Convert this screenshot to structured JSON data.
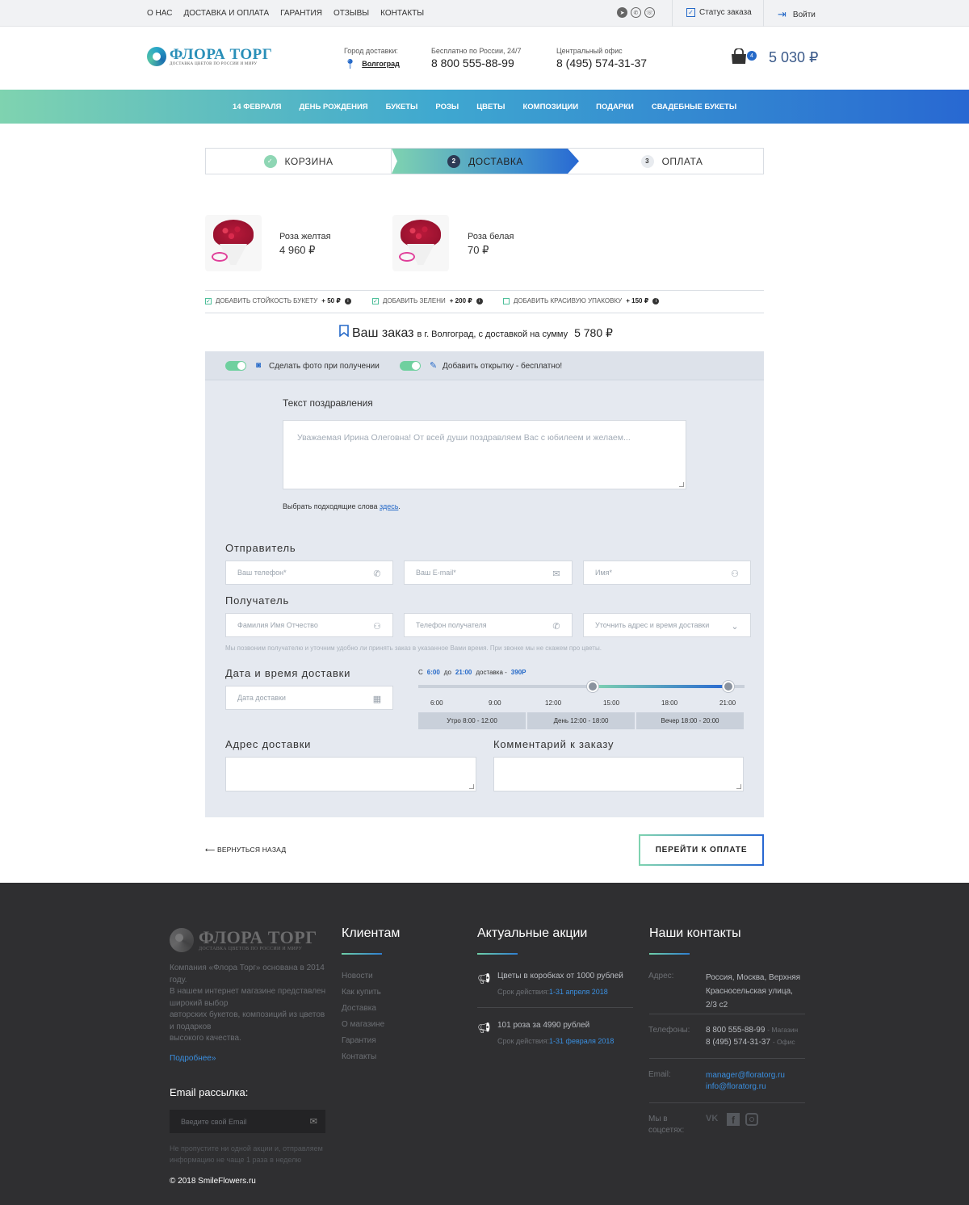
{
  "topbar": {
    "nav": [
      "О НАС",
      "ДОСТАВКА И ОПЛАТА",
      "ГАРАНТИЯ",
      "ОТЗЫВЫ",
      "КОНТАКТЫ"
    ],
    "order_status": "Статус заказа",
    "login": "Войти"
  },
  "header": {
    "logo_title": "ФЛОРА ТОРГ",
    "logo_sub": "ДОСТАВКА ЦВЕТОВ ПО РОССИИ И МИРУ",
    "city_label": "Город доставки:",
    "city_value": "Волгоград",
    "phone1_label": "Бесплатно по России, 24/7",
    "phone1": "8 800 555-88-99",
    "phone2_label": "Центральный офис",
    "phone2": "8 (495) 574-31-37",
    "cart_count": "4",
    "cart_total": "5 030 ₽"
  },
  "mainnav": [
    "14 ФЕВРАЛЯ",
    "ДЕНЬ РОЖДЕНИЯ",
    "БУКЕТЫ",
    "РОЗЫ",
    "ЦВЕТЫ",
    "КОМПОЗИЦИИ",
    "ПОДАРКИ",
    "СВАДЕБНЫЕ БУКЕТЫ"
  ],
  "steps": [
    {
      "num": "✓",
      "label": "КОРЗИНА"
    },
    {
      "num": "2",
      "label": "ДОСТАВКА"
    },
    {
      "num": "3",
      "label": "ОПЛАТА"
    }
  ],
  "products": [
    {
      "name": "Роза желтая",
      "price": "4 960 ₽"
    },
    {
      "name": "Роза белая",
      "price": "70 ₽"
    }
  ],
  "options": [
    {
      "label": "ДОБАВИТЬ СТОЙКОСТЬ БУКЕТУ",
      "price": "+ 50 ₽"
    },
    {
      "label": "ДОБАВИТЬ ЗЕЛЕНИ",
      "price": "+ 200 ₽"
    },
    {
      "label": "ДОБАВИТЬ КРАСИВУЮ УПАКОВКУ",
      "price": "+ 150 ₽"
    }
  ],
  "order": {
    "title": "Ваш заказ",
    "desc": "в г. Волгоград, с доставкой на сумму",
    "sum": "5 780 ₽"
  },
  "form": {
    "photo_toggle": "Сделать фото при получении",
    "card_toggle": "Добавить открытку - бесплатно!",
    "greeting_title": "Текст поздравления",
    "greeting_placeholder": "Уважаемая Ирина Олеговна! От всей души поздравляем Вас с юбилеем и желаем...",
    "pick_words": "Выбрать подходящие слова",
    "pick_link": "здесь",
    "sender_title": "Отправитель",
    "sender_phone": "Ваш телефон*",
    "sender_email": "Ваш E-mail*",
    "sender_name": "Имя*",
    "recipient_title": "Получатель",
    "recipient_name": "Фамилия Имя Отчество",
    "recipient_phone": "Телефон получателя",
    "recipient_address_select": "Уточнить адрес и время доставки",
    "recipient_note": "Мы позвоним получателю и уточним удобно ли принять заказ в указанное Вами время. При звонке мы не скажем про цветы.",
    "date_title": "Дата и время доставки",
    "date_placeholder": "Дата доставки",
    "range_from_label": "С",
    "range_from": "6:00",
    "range_to_label": "до",
    "range_to": "21:00",
    "range_price_label": "доставка -",
    "range_price": "390Р",
    "ticks": [
      "6:00",
      "9:00",
      "12:00",
      "15:00",
      "18:00",
      "21:00"
    ],
    "periods": [
      "Утро 8:00 - 12:00",
      "День 12:00 - 18:00",
      "Вечер 18:00 - 20:00"
    ],
    "address_title": "Адрес доставки",
    "comment_title": "Комментарий к заказу"
  },
  "actions": {
    "back": "⟵ ВЕРНУТЬСЯ НАЗАД",
    "pay": "ПЕРЕЙТИ К ОПЛАТЕ"
  },
  "footer": {
    "logo_title": "ФЛОРА ТОРГ",
    "logo_sub": "ДОСТАВКА ЦВЕТОВ ПО РОССИИ И МИРУ",
    "about": [
      "Компания «Флора Торг» основана в 2014 году.",
      "В нашем интернет магазине представлен широкий выбор",
      "авторских букетов, композиций из цветов и подарков",
      "высокого качества."
    ],
    "more": "Подробнее»",
    "newsletter_title": "Email рассылка:",
    "newsletter_placeholder": "Введите свой Email",
    "newsletter_note": "Не пропустите ни одной акции и, отправляем информацию не чаще 1 раза в неделю",
    "copyright": "© 2018 SmileFlowers.ru",
    "clients_title": "Клиентам",
    "clients_links": [
      "Новости",
      "Как купить",
      "Доставка",
      "О магазине",
      "Гарантия",
      "Контакты"
    ],
    "promos_title": "Актуальные акции",
    "promos": [
      {
        "title": "Цветы в коробках от 1000 рублей",
        "label": "Срок действия:",
        "period": "1-31 апреля 2018"
      },
      {
        "title": "101 роза за 4990 рублей",
        "label": "Срок действия:",
        "period": "1-31 февраля 2018"
      }
    ],
    "contacts_title": "Наши контакты",
    "address_label": "Адрес:",
    "address": [
      "Россия, Москва, Верхняя",
      "Красносельская улица,",
      "2/3 с2"
    ],
    "phones_label": "Телефоны:",
    "phone1": "8 800 555-88-99",
    "phone1_note": "- Магазин",
    "phone2": "8 (495) 574-31-37",
    "phone2_note": "- Офис",
    "email_label": "Email:",
    "email1": "manager@floratorg.ru",
    "email2": "info@floratorg.ru",
    "social_label": [
      "Мы в",
      "соцсетях:"
    ]
  }
}
